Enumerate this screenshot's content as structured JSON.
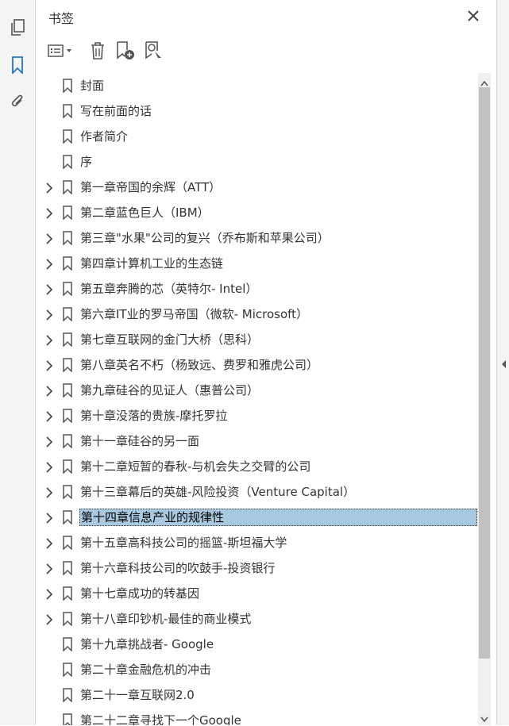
{
  "panel": {
    "title": "书签"
  },
  "rail": {
    "icons": [
      "pages-icon",
      "bookmark-icon",
      "attachment-icon"
    ]
  },
  "bookmarks": [
    {
      "label": "封面",
      "expandable": false
    },
    {
      "label": "写在前面的话",
      "expandable": false
    },
    {
      "label": "作者简介",
      "expandable": false
    },
    {
      "label": "序",
      "expandable": false
    },
    {
      "label": "第一章帝国的余辉（ATT）",
      "expandable": true
    },
    {
      "label": "第二章蓝色巨人（IBM）",
      "expandable": true
    },
    {
      "label": "第三章\"水果\"公司的复兴（乔布斯和苹果公司）",
      "expandable": true
    },
    {
      "label": "第四章计算机工业的生态链",
      "expandable": true
    },
    {
      "label": "第五章奔腾的芯（英特尔- Intel）",
      "expandable": true
    },
    {
      "label": "第六章IT业的罗马帝国（微软- Microsoft）",
      "expandable": true
    },
    {
      "label": "第七章互联网的金门大桥（思科）",
      "expandable": true
    },
    {
      "label": "第八章英名不朽（杨致远、费罗和雅虎公司）",
      "expandable": true
    },
    {
      "label": "第九章硅谷的见证人（惠普公司）",
      "expandable": true
    },
    {
      "label": "第十章没落的贵族-摩托罗拉",
      "expandable": true
    },
    {
      "label": "第十一章硅谷的另一面",
      "expandable": true
    },
    {
      "label": "第十二章短暂的春秋-与机会失之交臂的公司",
      "expandable": true
    },
    {
      "label": "第十三章幕后的英雄-风险投资（Venture Capital）",
      "expandable": true
    },
    {
      "label": "第十四章信息产业的规律性",
      "expandable": true,
      "selected": true
    },
    {
      "label": "第十五章高科技公司的摇篮-斯坦福大学",
      "expandable": true
    },
    {
      "label": "第十六章科技公司的吹鼓手-投资银行",
      "expandable": true
    },
    {
      "label": "第十七章成功的转基因",
      "expandable": true
    },
    {
      "label": "第十八章印钞机-最佳的商业模式",
      "expandable": true
    },
    {
      "label": "第十九章挑战者- Google",
      "expandable": false
    },
    {
      "label": "第二十章金融危机的冲击",
      "expandable": false
    },
    {
      "label": "第二十一章互联网2.0",
      "expandable": false
    },
    {
      "label": "第二十二章寻找下一个Google",
      "expandable": false
    }
  ]
}
